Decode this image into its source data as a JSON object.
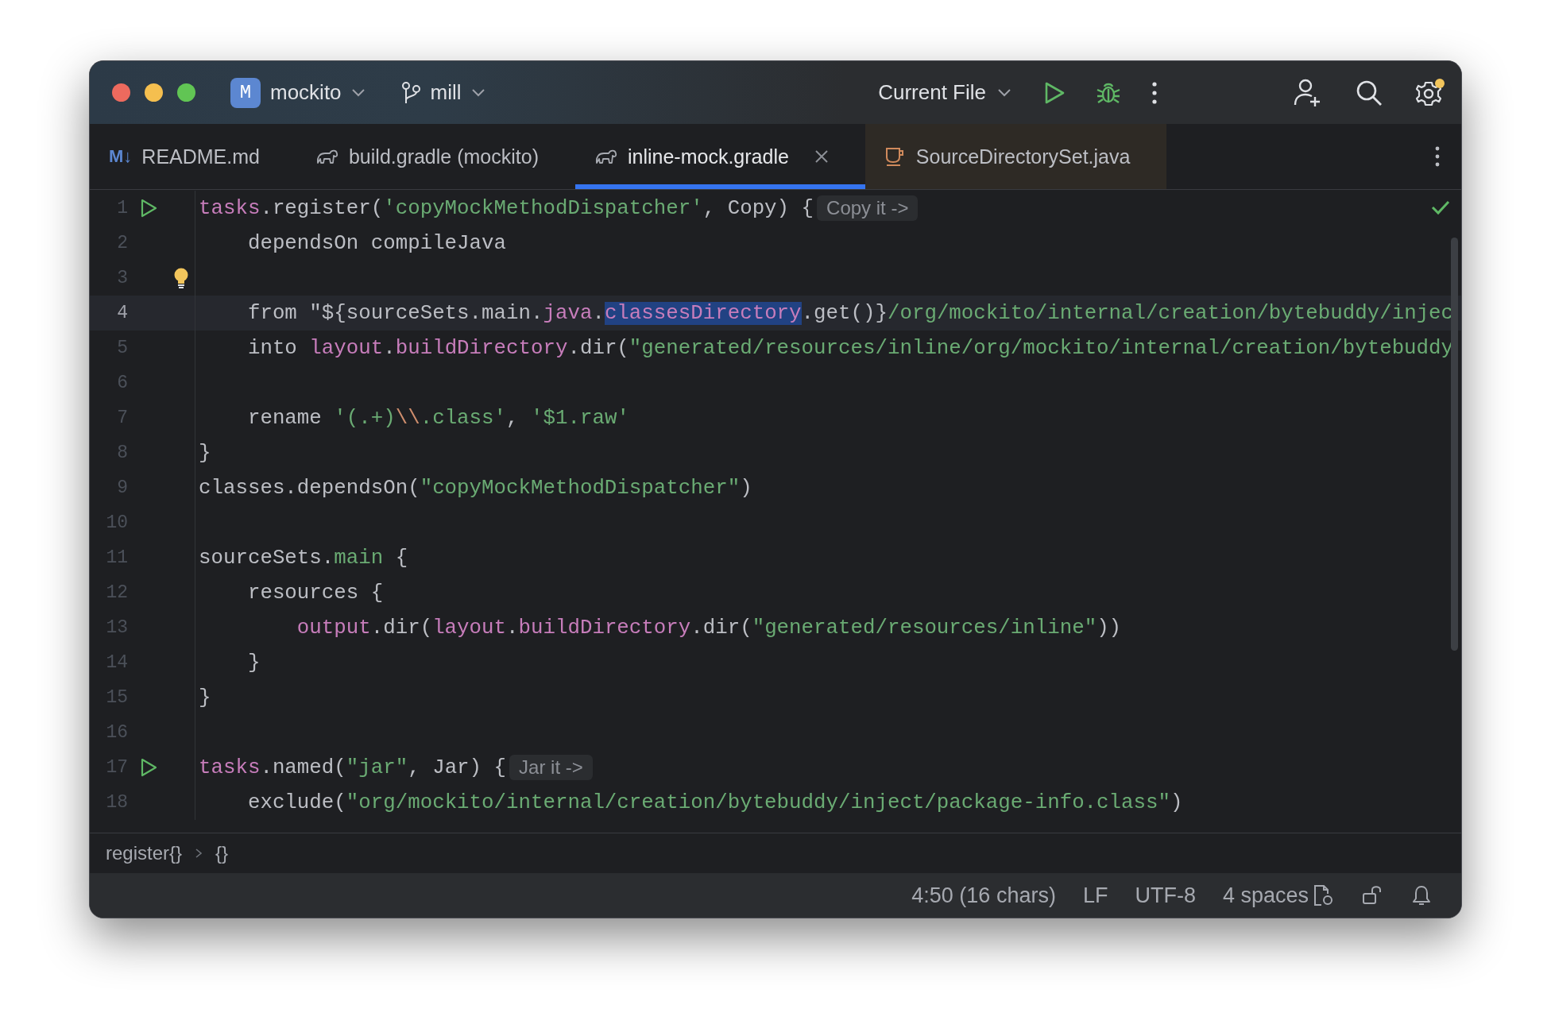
{
  "title_bar": {
    "project": {
      "badge": "M",
      "name": "mockito"
    },
    "branch": "mill",
    "run_config": "Current File"
  },
  "tabs": [
    {
      "kind": "markdown",
      "icon_text": "M↓",
      "label": "README.md",
      "selected": false,
      "closable": false
    },
    {
      "kind": "gradle",
      "label": "build.gradle (mockito)",
      "selected": false,
      "closable": false
    },
    {
      "kind": "gradle",
      "label": "inline-mock.gradle",
      "selected": true,
      "closable": true
    },
    {
      "kind": "java",
      "label": "SourceDirectorySet.java",
      "selected": false,
      "closable": false,
      "color": "#2e2a25"
    }
  ],
  "editor": {
    "lines": [
      {
        "number": "1",
        "run": true,
        "current": false,
        "bulb": false,
        "tokens": [
          {
            "t": "tasks",
            "kind": "kw"
          },
          {
            "t": ".register(",
            "kind": "plain"
          },
          {
            "t": "'copyMockMethodDispatcher'",
            "kind": "str"
          },
          {
            "t": ", Copy) {",
            "kind": "plain"
          }
        ],
        "hint": "Copy it ->"
      },
      {
        "number": "2",
        "run": false,
        "current": false,
        "bulb": false,
        "tokens": [
          {
            "t": "    dependsOn compileJava",
            "kind": "plain"
          }
        ]
      },
      {
        "number": "3",
        "run": false,
        "current": false,
        "bulb": true
      },
      {
        "number": "4",
        "run": false,
        "current": true,
        "bulb": false,
        "tokens": [
          {
            "t": "    from \"${sourceSets.main.",
            "kind": "plain"
          },
          {
            "t": "java",
            "kind": "kw"
          },
          {
            "t": ".",
            "kind": "plain"
          },
          {
            "t": "classesDirectory",
            "kind": "sel"
          },
          {
            "t": ".get()}",
            "kind": "plain"
          },
          {
            "t": "/org/mockito/internal/creation/bytebuddy/injec",
            "kind": "str"
          }
        ]
      },
      {
        "number": "5",
        "run": false,
        "current": false,
        "bulb": false,
        "tokens": [
          {
            "t": "    into ",
            "kind": "plain"
          },
          {
            "t": "layout",
            "kind": "kw"
          },
          {
            "t": ".",
            "kind": "plain"
          },
          {
            "t": "buildDirectory",
            "kind": "kw"
          },
          {
            "t": ".dir(",
            "kind": "plain"
          },
          {
            "t": "\"generated/resources/inline/org/mockito/internal/creation/bytebuddy",
            "kind": "str"
          }
        ]
      },
      {
        "number": "6",
        "run": false,
        "current": false,
        "bulb": false
      },
      {
        "number": "7",
        "run": false,
        "current": false,
        "bulb": false,
        "tokens": [
          {
            "t": "    rename ",
            "kind": "plain"
          },
          {
            "t": "'(.+)",
            "kind": "str"
          },
          {
            "t": "\\\\",
            "kind": "esc"
          },
          {
            "t": ".class'",
            "kind": "str"
          },
          {
            "t": ", ",
            "kind": "plain"
          },
          {
            "t": "'$1.raw'",
            "kind": "str"
          }
        ]
      },
      {
        "number": "8",
        "run": false,
        "current": false,
        "bulb": false,
        "tokens": [
          {
            "t": "}",
            "kind": "plain"
          }
        ]
      },
      {
        "number": "9",
        "run": false,
        "current": false,
        "bulb": false,
        "tokens": [
          {
            "t": "classes.dependsOn(",
            "kind": "plain"
          },
          {
            "t": "\"copyMockMethodDispatcher\"",
            "kind": "str"
          },
          {
            "t": ")",
            "kind": "plain"
          }
        ]
      },
      {
        "number": "10",
        "run": false,
        "current": false,
        "bulb": false
      },
      {
        "number": "11",
        "run": false,
        "current": false,
        "bulb": false,
        "tokens": [
          {
            "t": "sourceSets.",
            "kind": "plain"
          },
          {
            "t": "main",
            "kind": "str"
          },
          {
            "t": " {",
            "kind": "plain"
          }
        ]
      },
      {
        "number": "12",
        "run": false,
        "current": false,
        "bulb": false,
        "tokens": [
          {
            "t": "    resources {",
            "kind": "plain"
          }
        ]
      },
      {
        "number": "13",
        "run": false,
        "current": false,
        "bulb": false,
        "tokens": [
          {
            "t": "        output",
            "kind": "kw"
          },
          {
            "t": ".dir(",
            "kind": "plain"
          },
          {
            "t": "layout",
            "kind": "kw"
          },
          {
            "t": ".",
            "kind": "plain"
          },
          {
            "t": "buildDirectory",
            "kind": "kw"
          },
          {
            "t": ".dir(",
            "kind": "plain"
          },
          {
            "t": "\"generated/resources/inline\"",
            "kind": "str"
          },
          {
            "t": "))",
            "kind": "plain"
          }
        ]
      },
      {
        "number": "14",
        "run": false,
        "current": false,
        "bulb": false,
        "tokens": [
          {
            "t": "    }",
            "kind": "plain"
          }
        ]
      },
      {
        "number": "15",
        "run": false,
        "current": false,
        "bulb": false,
        "tokens": [
          {
            "t": "}",
            "kind": "plain"
          }
        ]
      },
      {
        "number": "16",
        "run": false,
        "current": false,
        "bulb": false
      },
      {
        "number": "17",
        "run": true,
        "current": false,
        "bulb": false,
        "tokens": [
          {
            "t": "tasks",
            "kind": "kw"
          },
          {
            "t": ".named(",
            "kind": "plain"
          },
          {
            "t": "\"jar\"",
            "kind": "str"
          },
          {
            "t": ", Jar) {",
            "kind": "plain"
          }
        ],
        "hint": "Jar it ->"
      },
      {
        "number": "18",
        "run": false,
        "current": false,
        "bulb": false,
        "tokens": [
          {
            "t": "    exclude(",
            "kind": "plain"
          },
          {
            "t": "\"org/mockito/internal/creation/bytebuddy/inject/package-info.class\"",
            "kind": "str"
          },
          {
            "t": ")",
            "kind": "plain"
          }
        ]
      }
    ]
  },
  "breadcrumbs": [
    "register{}",
    "{}"
  ],
  "status_bar": {
    "position": "4:50 (16 chars)",
    "line_separator": "LF",
    "encoding": "UTF-8",
    "indent": "4 spaces"
  }
}
